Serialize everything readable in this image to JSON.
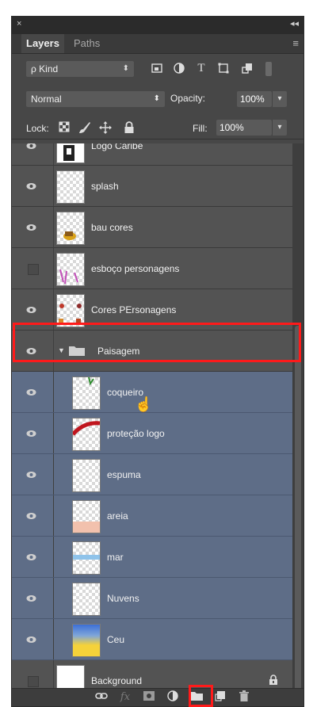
{
  "panel": {
    "close": "×",
    "collapse": "◂◂",
    "tabs": {
      "active": "Layers",
      "inactive": "Paths",
      "menu": "≡"
    }
  },
  "filter": {
    "kind_label": "ρ Kind",
    "arrow": "⬍"
  },
  "blend": {
    "mode": "Normal",
    "arrow": "⬍",
    "opacity_label": "Opacity:",
    "opacity_value": "100%",
    "dd": "▾"
  },
  "lock": {
    "label": "Lock:",
    "fill_label": "Fill:",
    "fill_value": "100%",
    "dd": "▾"
  },
  "layers": [
    {
      "name": "Logo Caribe",
      "visible": true,
      "selected": false
    },
    {
      "name": "splash",
      "visible": true,
      "selected": false
    },
    {
      "name": "bau cores",
      "visible": true,
      "selected": false
    },
    {
      "name": "esboço personagens",
      "visible": false,
      "selected": false
    },
    {
      "name": "Cores PErsonagens",
      "visible": true,
      "selected": false
    },
    {
      "name": "Paisagem",
      "visible": true,
      "selected": false,
      "group": true
    },
    {
      "name": "coqueiro",
      "visible": true,
      "selected": true
    },
    {
      "name": "proteção logo",
      "visible": true,
      "selected": true
    },
    {
      "name": "espuma",
      "visible": true,
      "selected": true
    },
    {
      "name": "areia",
      "visible": true,
      "selected": true
    },
    {
      "name": "mar",
      "visible": true,
      "selected": true
    },
    {
      "name": "Nuvens",
      "visible": true,
      "selected": true
    },
    {
      "name": "Ceu",
      "visible": true,
      "selected": true
    },
    {
      "name": "Background",
      "visible": false,
      "selected": false,
      "locked": true
    }
  ],
  "colors": {
    "selection": "#5e6d87",
    "highlight": "#ff1a1a",
    "panel": "#474747"
  }
}
